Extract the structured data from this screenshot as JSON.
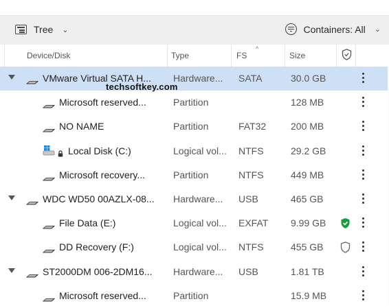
{
  "toolbar": {
    "view_label": "Tree",
    "containers_label": "Containers: All"
  },
  "columns": {
    "device": "Device/Disk",
    "type": "Type",
    "fs": "FS",
    "size": "Size"
  },
  "watermark": "techsoftkey.com",
  "rows": [
    {
      "name": "VMware Virtual SATA H...",
      "type": "Hardware...",
      "fs": "SATA",
      "size": "30.0 GB",
      "level": 0,
      "expandable": true,
      "selected": true,
      "icon": "disk-icon",
      "status": ""
    },
    {
      "name": "Microsoft reserved...",
      "type": "Partition",
      "fs": "",
      "size": "128 MB",
      "level": 1,
      "icon": "disk-icon",
      "status": ""
    },
    {
      "name": "NO NAME",
      "type": "Partition",
      "fs": "FAT32",
      "size": "200 MB",
      "level": 1,
      "icon": "disk-icon",
      "status": ""
    },
    {
      "name": "Local Disk (C:)",
      "type": "Logical vol...",
      "fs": "NTFS",
      "size": "29.2 GB",
      "level": 1,
      "icon": "windows-disk-icon",
      "locked": true,
      "status": ""
    },
    {
      "name": "Microsoft recovery...",
      "type": "Partition",
      "fs": "NTFS",
      "size": "449 MB",
      "level": 1,
      "icon": "disk-icon",
      "status": ""
    },
    {
      "name": "WDC WD50 00AZLX-08...",
      "type": "Hardware...",
      "fs": "USB",
      "size": "465 GB",
      "level": 0,
      "expandable": true,
      "icon": "disk-icon",
      "status": ""
    },
    {
      "name": "File Data (E:)",
      "type": "Logical vol...",
      "fs": "EXFAT",
      "size": "9.99 GB",
      "level": 1,
      "icon": "disk-icon",
      "status": "protected"
    },
    {
      "name": "DD Recovery (F:)",
      "type": "Logical vol...",
      "fs": "NTFS",
      "size": "455 GB",
      "level": 1,
      "icon": "disk-icon",
      "status": "unprotected"
    },
    {
      "name": "ST2000DM 006-2DM16...",
      "type": "Hardware...",
      "fs": "USB",
      "size": "1.81 TB",
      "level": 0,
      "expandable": true,
      "icon": "disk-icon",
      "status": ""
    },
    {
      "name": "Microsoft reserved...",
      "type": "Partition",
      "fs": "",
      "size": "15.9 MB",
      "level": 1,
      "icon": "disk-icon",
      "status": ""
    }
  ],
  "colors": {
    "selected_row": "#cde0f5",
    "protected_green": "#1a9b3c",
    "toolbar_bg": "#efefef"
  }
}
